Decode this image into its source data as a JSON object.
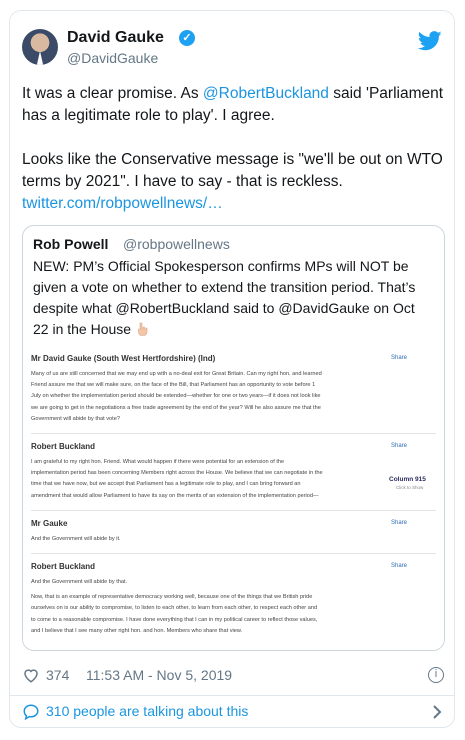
{
  "author": {
    "name": "David Gauke",
    "handle": "@DavidGauke"
  },
  "tweet": {
    "line1_pre": "It was a clear promise. As ",
    "line1_mention": "@RobertBuckland",
    "line1_post": " said 'Parliament has a legitimate role to play'. I agree.",
    "line2": "Looks like the Conservative message is \"we'll be out on WTO terms by 2021\". I have to say - that is reckless.",
    "link": "twitter.com/robpowellnews/…"
  },
  "quoted": {
    "name": "Rob Powell",
    "handle": "@robpowellnews",
    "text": "NEW: PM’s Official Spokesperson confirms MPs will NOT be given a vote on whether to extend the transition period. That’s despite what @RobertBuckland said to @DavidGauke on Oct 22 in the House"
  },
  "hansard": {
    "share_label": "Share",
    "column_label": "Column 915",
    "column_sub": "Click to Show",
    "blocks": [
      {
        "speaker": "Mr David Gauke (South West Hertfordshire) (Ind)",
        "lines": [
          "Many of us are still concerned that we may end up with a no-deal exit for Great Britain. Can my right hon. and learned",
          "Friend assure me that we will make sure, on the face of the Bill, that Parliament has an opportunity to vote before 1",
          "July on whether the implementation period should be extended—whether for one or two years—if it does not look like",
          "we are going to get in the negotiations a free trade agreement by the end of the year? Will he also assure me that the",
          "Government will abide by that vote?"
        ]
      },
      {
        "speaker": "Robert Buckland",
        "lines": [
          "I am grateful to my right hon. Friend. What would happen if there were potential for an extension of the",
          "implementation period has been concerning Members right across the House. We believe that we can negotiate in the",
          "time that we have now, but we accept that Parliament has a legitimate role to play, and I can bring forward an",
          "amendment that would allow Parliament to have its say on the merits of an extension of the implementation period—"
        ]
      },
      {
        "speaker": "Mr Gauke",
        "lines": [
          "And the Government will abide by it."
        ]
      },
      {
        "speaker": "Robert Buckland",
        "lines": [
          "And the Government will abide by that.",
          "Now, that is an example of representative democracy working well, because one of the things that we British pride",
          "ourselves on is our ability to compromise, to listen to each other, to learn from each other, to respect each other and",
          "to come to a reasonable compromise. I have done everything that I can in my political career to reflect those values,",
          "and I believe that I see many other right hon. and hon. Members who share that view."
        ]
      }
    ]
  },
  "footer": {
    "likes": "374",
    "timestamp": "11:53 AM - Nov 5, 2019",
    "talking": "310 people are talking about this"
  },
  "colors": {
    "accent": "#1b95e0",
    "verified": "#1da1f2",
    "muted": "#657786"
  },
  "icons": [
    "twitter-bird-icon",
    "verified-badge-icon",
    "pointing-down-icon",
    "heart-icon",
    "info-icon",
    "comment-bubble-icon",
    "chevron-right-icon",
    "share-icon"
  ]
}
